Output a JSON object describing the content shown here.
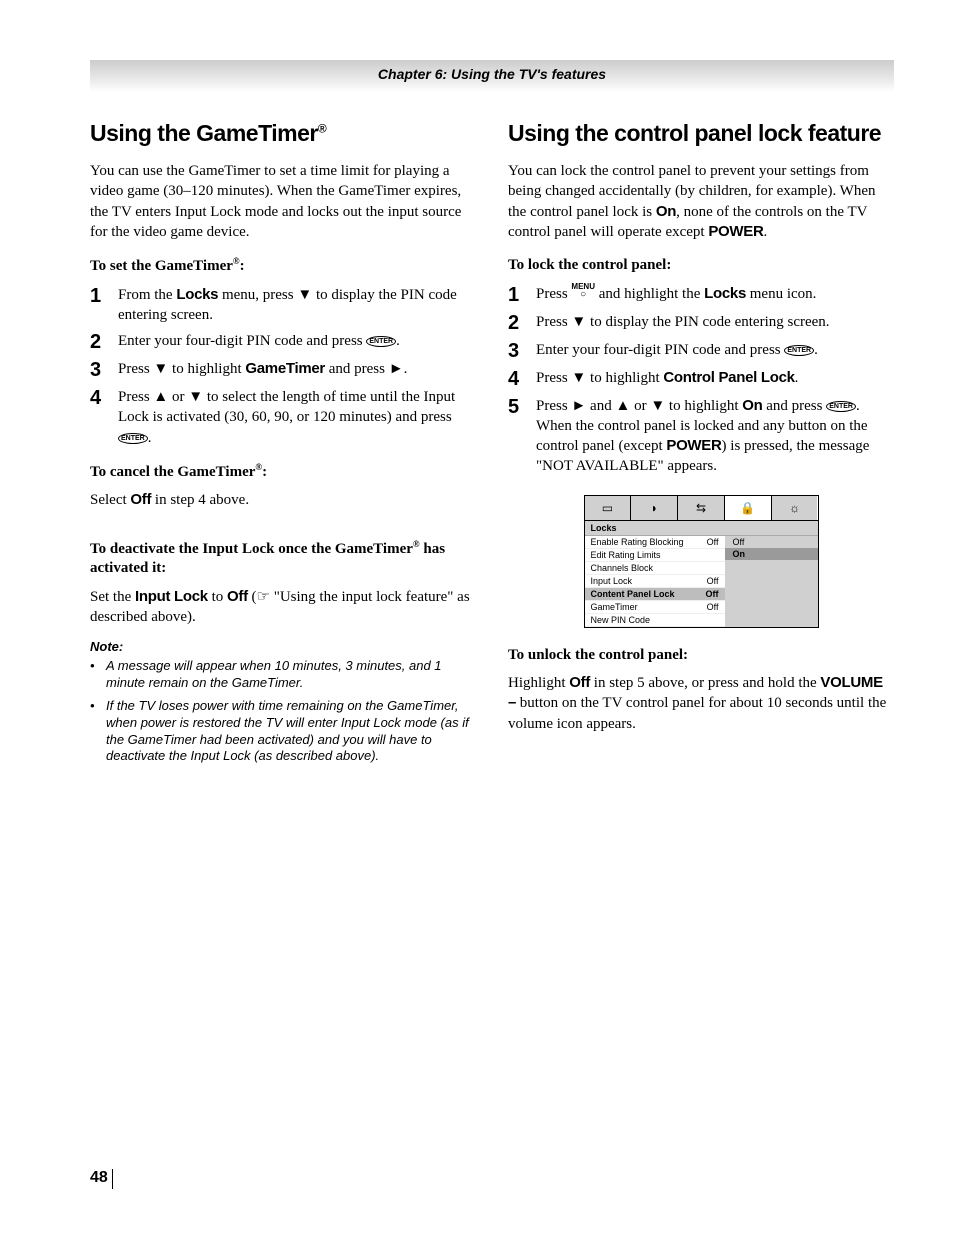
{
  "chapter_bar": "Chapter 6: Using the TV's features",
  "page_number": "48",
  "left": {
    "heading": "Using the GameTimer",
    "heading_sup": "®",
    "intro": "You can use the GameTimer to set a time limit for playing a video game (30–120 minutes). When the GameTimer expires, the TV enters Input Lock mode and locks out the input source for the video game device.",
    "sub1": "To set the GameTimer",
    "sub1_sup": "®",
    "sub1_colon": ":",
    "steps": {
      "s1a": "From the ",
      "s1b": "Locks",
      "s1c": " menu, press ",
      "s1d": " to display the PIN code entering screen.",
      "s2a": "Enter your four-digit PIN code and press ",
      "s2b": ".",
      "s3a": "Press ",
      "s3b": " to highlight ",
      "s3c": "GameTimer",
      "s3d": " and press ",
      "s3e": ".",
      "s4a": "Press ",
      "s4b": " or ",
      "s4c": " to select the length of time until the Input Lock is activated (30, 60, 90, or 120 minutes) and press ",
      "s4d": "."
    },
    "sub2": "To cancel the GameTimer",
    "sub2_sup": "®",
    "sub2_colon": ":",
    "cancel_a": "Select ",
    "cancel_b": "Off",
    "cancel_c": " in step 4 above.",
    "sub3a": "To deactivate the Input Lock once the GameTimer",
    "sub3_sup": "®",
    "sub3b": " has activated it:",
    "deact_a": "Set the ",
    "deact_b": "Input Lock",
    "deact_c": " to ",
    "deact_d": "Off",
    "deact_e": " (",
    "deact_f": " \"Using the input lock feature\" as described above).",
    "note_head": "Note:",
    "notes": {
      "n1": "A message will appear when 10 minutes, 3 minutes, and 1 minute remain on the GameTimer.",
      "n2": "If the TV loses power with time remaining on the GameTimer, when power is restored the TV will enter Input Lock mode (as if the GameTimer had been activated) and you will have to deactivate the Input Lock (as described above)."
    }
  },
  "right": {
    "heading": "Using the control panel lock feature",
    "intro_a": "You can lock the control panel to prevent your settings from being changed accidentally (by children, for example). When the control panel lock is ",
    "intro_b": "On",
    "intro_c": ", none of the controls on the TV control panel will operate except ",
    "intro_d": "POWER",
    "intro_e": ".",
    "sub1": "To lock the control panel:",
    "steps": {
      "s1a": "Press ",
      "s1b": " and highlight the ",
      "s1c": "Locks",
      "s1d": " menu icon.",
      "s2a": "Press ",
      "s2b": " to display the PIN code entering screen.",
      "s3a": "Enter your four-digit PIN code and press ",
      "s3b": ".",
      "s4a": "Press ",
      "s4b": " to highlight ",
      "s4c": "Control Panel Lock",
      "s4d": ".",
      "s5a": "Press ",
      "s5b": " and ",
      "s5c": " or ",
      "s5d": " to highlight ",
      "s5e": "On",
      "s5f": " and press ",
      "s5g": ". When the control panel is locked and any button on the control panel (except ",
      "s5h": "POWER",
      "s5i": ") is pressed, the message \"NOT AVAILABLE\" appears."
    },
    "osd": {
      "title": "Locks",
      "rows": [
        {
          "label": "Enable Rating Blocking",
          "val": "Off"
        },
        {
          "label": "Edit Rating Limits",
          "val": ""
        },
        {
          "label": "Channels Block",
          "val": ""
        },
        {
          "label": "Input Lock",
          "val": "Off"
        },
        {
          "label": "Content Panel Lock",
          "val": "Off",
          "sel": true
        },
        {
          "label": "GameTimer",
          "val": "Off"
        },
        {
          "label": "New PIN Code",
          "val": ""
        }
      ],
      "opts": [
        {
          "t": "Off"
        },
        {
          "t": "On",
          "sel": true
        }
      ]
    },
    "sub2": "To unlock the control panel:",
    "unlock_a": "Highlight ",
    "unlock_b": "Off",
    "unlock_c": " in step 5 above, or press and hold the ",
    "unlock_d": "VOLUME –",
    "unlock_e": " button on the TV control panel for about 10 seconds until the volume icon appears."
  },
  "glyphs": {
    "down": "▼",
    "up": "▲",
    "right": "►",
    "enter": "ENTER",
    "menu": "MENU",
    "pointer": "☞"
  }
}
